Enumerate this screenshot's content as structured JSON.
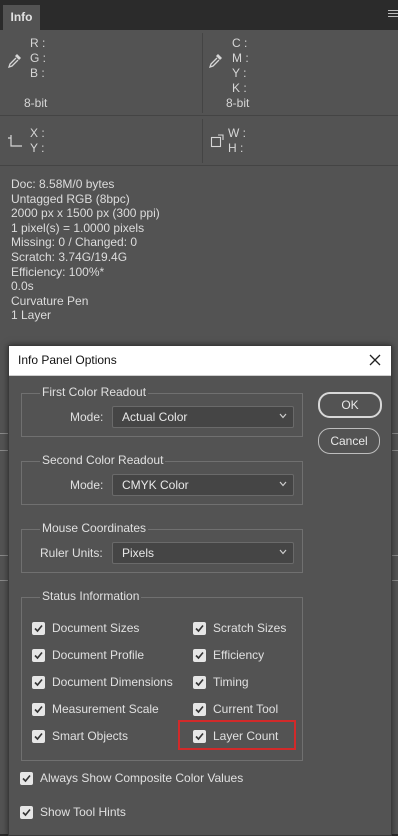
{
  "panel": {
    "tab_label": "Info",
    "rgb_labels": [
      "R :",
      "G :",
      "B :"
    ],
    "cmyk_labels": [
      "C :",
      "M :",
      "Y :",
      "K :"
    ],
    "bit_depth_left": "8-bit",
    "bit_depth_right": "8-bit",
    "xy_labels": [
      "X :",
      "Y :"
    ],
    "wh_labels": [
      "W :",
      "H :"
    ],
    "status_lines": [
      "Doc: 8.58M/0 bytes",
      "Untagged RGB (8bpc)",
      "2000 px x 1500 px (300 ppi)",
      "1 pixel(s) = 1.0000 pixels",
      "Missing: 0 / Changed: 0",
      "Scratch: 3.74G/19.4G",
      "Efficiency: 100%*",
      "0.0s",
      "Curvature Pen",
      "1 Layer"
    ]
  },
  "dialog": {
    "title": "Info Panel Options",
    "ok_label": "OK",
    "cancel_label": "Cancel",
    "first_readout": {
      "title": "First Color Readout",
      "mode_label": "Mode:",
      "mode_value": "Actual Color"
    },
    "second_readout": {
      "title": "Second Color Readout",
      "mode_label": "Mode:",
      "mode_value": "CMYK Color"
    },
    "mouse_coords": {
      "title": "Mouse Coordinates",
      "units_label": "Ruler Units:",
      "units_value": "Pixels"
    },
    "status_info": {
      "title": "Status Information",
      "left": [
        {
          "label": "Document Sizes",
          "checked": true
        },
        {
          "label": "Document Profile",
          "checked": true
        },
        {
          "label": "Document Dimensions",
          "checked": true
        },
        {
          "label": "Measurement Scale",
          "checked": true
        },
        {
          "label": "Smart Objects",
          "checked": true
        }
      ],
      "right": [
        {
          "label": "Scratch Sizes",
          "checked": true
        },
        {
          "label": "Efficiency",
          "checked": true
        },
        {
          "label": "Timing",
          "checked": true
        },
        {
          "label": "Current Tool",
          "checked": true
        },
        {
          "label": "Layer Count",
          "checked": true
        }
      ]
    },
    "always_show_composite": {
      "label": "Always Show Composite Color Values",
      "checked": true
    },
    "show_tool_hints": {
      "label": "Show Tool Hints",
      "checked": true
    }
  },
  "colors": {
    "panel_bg": "#535353",
    "highlight": "#d12a2a"
  }
}
